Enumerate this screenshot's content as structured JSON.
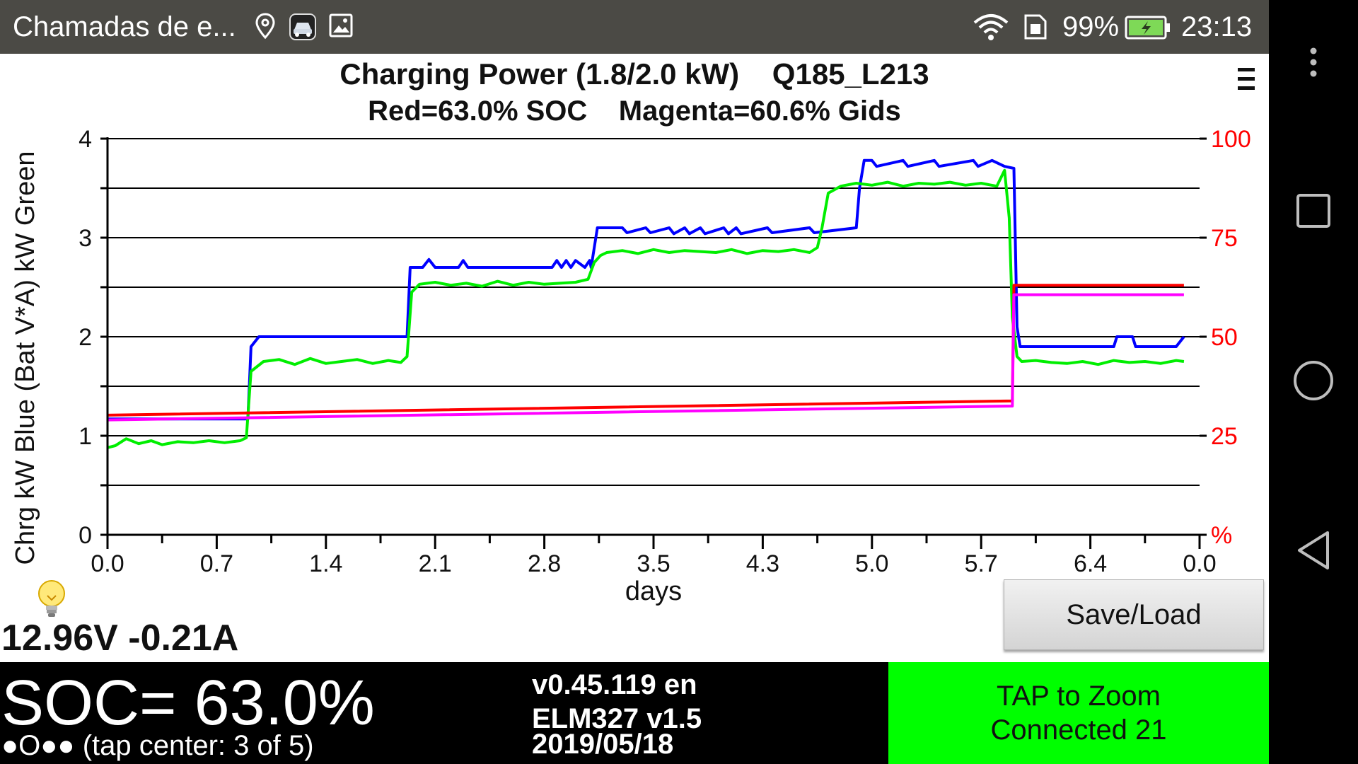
{
  "status_bar": {
    "title": "Chamadas de e...",
    "battery_percent": "99%",
    "time": "23:13",
    "icons": [
      "location-pin-icon",
      "car-app-icon",
      "image-icon",
      "wifi-icon",
      "sim-card-icon",
      "battery-charging-icon"
    ]
  },
  "nav_bar": {
    "icons": [
      "overflow-menu-icon",
      "recents-square-icon",
      "home-circle-icon",
      "back-triangle-icon"
    ]
  },
  "chart_data": {
    "type": "line",
    "title": "Charging Power (1.8/2.0 kW)    Q185_L213",
    "subtitle": "Red=63.0% SOC    Magenta=60.6% Gids",
    "xlabel": "days",
    "ylabel": "Chrg kW Blue  (Bat V*A) kW Green",
    "x_tick_labels": [
      "0.0",
      "0.7",
      "1.4",
      "2.1",
      "2.8",
      "3.5",
      "4.3",
      "5.0",
      "5.7",
      "6.4",
      "0.0"
    ],
    "xlim": [
      0,
      7
    ],
    "ylim": [
      0,
      4
    ],
    "y_ticks": [
      0,
      1,
      2,
      3,
      4
    ],
    "y2lim": [
      0,
      100
    ],
    "y2_tick_labels": [
      "%",
      "25",
      "50",
      "75",
      "100"
    ],
    "grid": "horizontal",
    "colors": {
      "blue": "#0000ff",
      "green": "#00ee00",
      "red": "#ff0000",
      "magenta": "#ff00ff",
      "right_axis": "#ff0000"
    },
    "series": [
      {
        "name": "Blue",
        "axis": "left",
        "x": [
          0,
          0.01,
          0.9,
          0.92,
          0.97,
          1.92,
          1.94,
          2.02,
          2.06,
          2.1,
          2.25,
          2.28,
          2.31,
          2.85,
          2.88,
          2.91,
          2.94,
          2.97,
          3.0,
          3.06,
          3.09,
          3.1,
          3.14,
          3.3,
          3.33,
          3.45,
          3.48,
          3.6,
          3.63,
          3.7,
          3.73,
          3.8,
          3.83,
          3.95,
          3.98,
          4.03,
          4.06,
          4.23,
          4.26,
          4.5,
          4.53,
          4.8,
          4.82,
          4.85,
          4.9,
          4.93,
          5.1,
          5.13,
          5.3,
          5.33,
          5.55,
          5.58,
          5.67,
          5.75,
          5.81,
          5.83,
          5.85,
          6.45,
          6.47,
          6.57,
          6.59,
          6.85,
          6.9
        ],
        "y": [
          1.17,
          1.17,
          1.17,
          1.9,
          2.0,
          2.0,
          2.7,
          2.7,
          2.78,
          2.7,
          2.7,
          2.77,
          2.7,
          2.7,
          2.77,
          2.7,
          2.77,
          2.7,
          2.77,
          2.7,
          2.77,
          2.7,
          3.1,
          3.1,
          3.05,
          3.1,
          3.05,
          3.1,
          3.04,
          3.1,
          3.04,
          3.1,
          3.04,
          3.1,
          3.04,
          3.1,
          3.04,
          3.1,
          3.05,
          3.1,
          3.05,
          3.1,
          3.5,
          3.78,
          3.78,
          3.72,
          3.78,
          3.72,
          3.78,
          3.72,
          3.78,
          3.72,
          3.78,
          3.72,
          3.7,
          2.1,
          1.9,
          1.9,
          2.0,
          2.0,
          1.9,
          1.9,
          2.0
        ]
      },
      {
        "name": "Green",
        "axis": "left",
        "x": [
          0,
          0.05,
          0.12,
          0.2,
          0.28,
          0.35,
          0.45,
          0.55,
          0.65,
          0.75,
          0.85,
          0.89,
          0.92,
          0.96,
          1.0,
          1.1,
          1.2,
          1.3,
          1.4,
          1.5,
          1.6,
          1.7,
          1.8,
          1.88,
          1.92,
          1.95,
          2.0,
          2.1,
          2.2,
          2.3,
          2.4,
          2.5,
          2.6,
          2.7,
          2.8,
          2.9,
          3.0,
          3.08,
          3.12,
          3.16,
          3.2,
          3.3,
          3.4,
          3.5,
          3.6,
          3.7,
          3.8,
          3.9,
          4.0,
          4.1,
          4.2,
          4.3,
          4.4,
          4.5,
          4.55,
          4.58,
          4.62,
          4.7,
          4.8,
          4.9,
          5.0,
          5.1,
          5.2,
          5.3,
          5.4,
          5.5,
          5.6,
          5.7,
          5.75,
          5.78,
          5.8,
          5.83,
          5.86,
          5.95,
          6.05,
          6.15,
          6.25,
          6.35,
          6.45,
          6.55,
          6.65,
          6.75,
          6.85,
          6.9
        ],
        "y": [
          0.88,
          0.9,
          0.97,
          0.92,
          0.95,
          0.91,
          0.94,
          0.93,
          0.95,
          0.93,
          0.95,
          0.98,
          1.65,
          1.7,
          1.75,
          1.77,
          1.72,
          1.78,
          1.73,
          1.75,
          1.77,
          1.73,
          1.76,
          1.74,
          1.8,
          2.45,
          2.53,
          2.55,
          2.52,
          2.54,
          2.51,
          2.56,
          2.52,
          2.55,
          2.53,
          2.54,
          2.55,
          2.58,
          2.75,
          2.82,
          2.85,
          2.87,
          2.84,
          2.88,
          2.85,
          2.87,
          2.86,
          2.85,
          2.88,
          2.84,
          2.87,
          2.86,
          2.88,
          2.85,
          2.9,
          3.1,
          3.45,
          3.52,
          3.55,
          3.53,
          3.56,
          3.52,
          3.55,
          3.54,
          3.56,
          3.53,
          3.55,
          3.52,
          3.68,
          3.2,
          2.2,
          1.8,
          1.75,
          1.76,
          1.74,
          1.73,
          1.75,
          1.72,
          1.76,
          1.74,
          1.75,
          1.73,
          1.76,
          1.75
        ]
      },
      {
        "name": "Red",
        "axis": "right",
        "x": [
          0,
          5.8,
          5.81,
          6.9
        ],
        "y": [
          30.2,
          33.8,
          63.0,
          63.0
        ]
      },
      {
        "name": "Magenta",
        "axis": "right",
        "x": [
          0,
          5.8,
          5.81,
          6.9
        ],
        "y": [
          29.0,
          32.5,
          60.6,
          60.6
        ]
      }
    ]
  },
  "readouts": {
    "voltage_current": "12.96V -0.21A",
    "soc": "SOC= 63.0%",
    "page_indicator": "●O●● (tap center: 3 of 5)"
  },
  "version_info": {
    "version": "v0.45.119 en",
    "adapter": "ELM327 v1.5",
    "date": "2019/05/18"
  },
  "buttons": {
    "save_load": "Save/Load",
    "zoom_line1": "TAP to Zoom",
    "zoom_line2": "Connected 21"
  }
}
